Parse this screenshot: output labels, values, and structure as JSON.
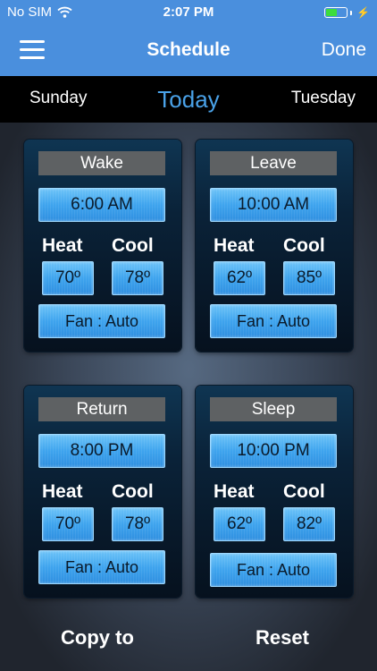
{
  "status_bar": {
    "carrier": "No SIM",
    "time": "2:07 PM",
    "battery_level": 0.55,
    "battery_color": "#3ddc3d"
  },
  "nav": {
    "title": "Schedule",
    "done_label": "Done",
    "menu_icon": "hamburger-menu-icon"
  },
  "days": {
    "prev": "Sunday",
    "current": "Today",
    "next": "Tuesday"
  },
  "labels": {
    "heat": "Heat",
    "cool": "Cool"
  },
  "periods": [
    {
      "name": "Wake",
      "time": "6:00 AM",
      "heat": "70º",
      "cool": "78º",
      "fan": "Fan : Auto"
    },
    {
      "name": "Leave",
      "time": "10:00 AM",
      "heat": "62º",
      "cool": "85º",
      "fan": "Fan : Auto"
    },
    {
      "name": "Return",
      "time": "8:00 PM",
      "heat": "70º",
      "cool": "78º",
      "fan": "Fan : Auto"
    },
    {
      "name": "Sleep",
      "time": "10:00 PM",
      "heat": "62º",
      "cool": "82º",
      "fan": "Fan : Auto"
    }
  ],
  "footer": {
    "copy_label": "Copy to",
    "reset_label": "Reset"
  },
  "colors": {
    "accent": "#4a8fdd",
    "selected_day": "#4aa2e8"
  }
}
